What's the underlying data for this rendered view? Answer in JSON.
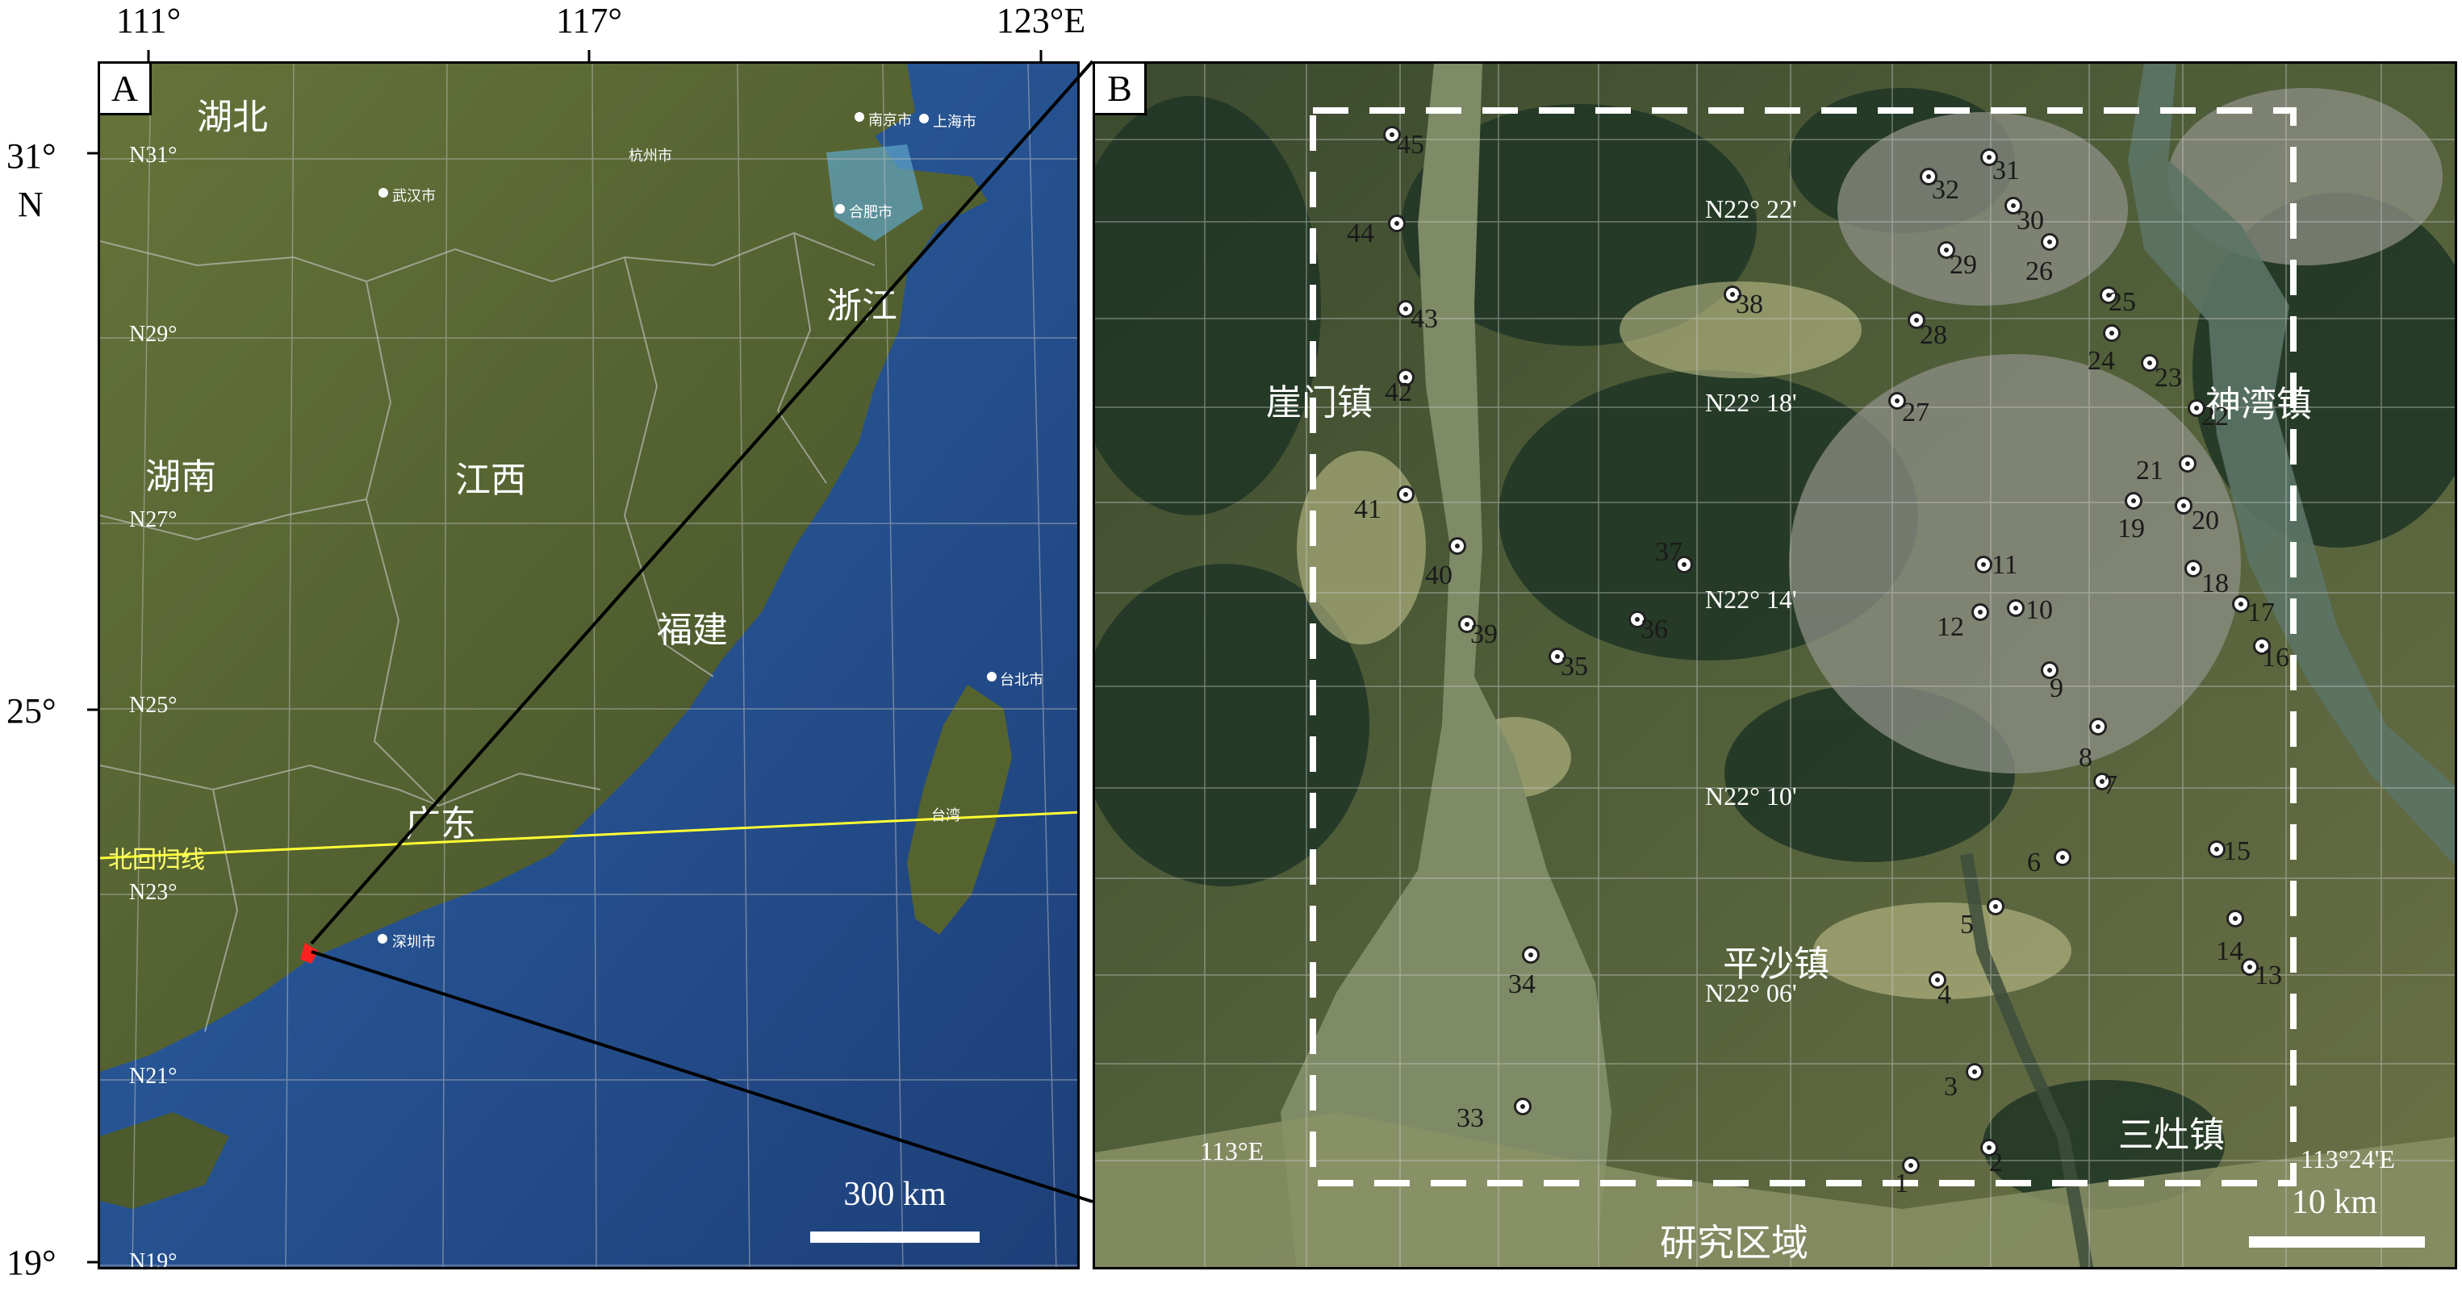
{
  "axes": {
    "top_labels": [
      {
        "text": "111°",
        "left": 0.0
      },
      {
        "text": "117°",
        "left": 0.5
      },
      {
        "text": "123°E",
        "left": 1.0
      }
    ],
    "left_labels": [
      {
        "text": "31°",
        "top": 0.0
      },
      {
        "text": "N",
        "top": 0.05
      },
      {
        "text": "25°",
        "top": 0.5
      },
      {
        "text": "19°",
        "top": 1.0
      }
    ]
  },
  "panel_a": {
    "label": "A",
    "provinces": [
      "湖北",
      "湖南",
      "江西",
      "浙江",
      "福建",
      "广东"
    ],
    "lat_labels": [
      "N31°",
      "N29°",
      "N27°",
      "N25°",
      "N23°",
      "N21°",
      "N19°"
    ],
    "cities": [
      "武汉市",
      "南京市",
      "上海市",
      "合肥市",
      "杭州市",
      "台北市",
      "深圳市",
      "台湾"
    ],
    "tropic_label": "北回归线",
    "scale": "300 km"
  },
  "panel_b": {
    "label": "B",
    "towns": [
      "崖门镇",
      "神湾镇",
      "平沙镇",
      "三灶镇"
    ],
    "grid_labels": [
      "N22° 22'",
      "N22° 18'",
      "N22° 14'",
      "N22° 10'",
      "N22° 06'"
    ],
    "lon_left": "113°E",
    "lon_right": "113°24'E",
    "study_area": "研究区域",
    "scale": "10 km",
    "sites": [
      {
        "n": "1"
      },
      {
        "n": "2"
      },
      {
        "n": "3"
      },
      {
        "n": "4"
      },
      {
        "n": "5"
      },
      {
        "n": "6"
      },
      {
        "n": "7"
      },
      {
        "n": "8"
      },
      {
        "n": "9"
      },
      {
        "n": "10"
      },
      {
        "n": "11"
      },
      {
        "n": "12"
      },
      {
        "n": "13"
      },
      {
        "n": "14"
      },
      {
        "n": "15"
      },
      {
        "n": "16"
      },
      {
        "n": "17"
      },
      {
        "n": "18"
      },
      {
        "n": "19"
      },
      {
        "n": "20"
      },
      {
        "n": "21"
      },
      {
        "n": "22"
      },
      {
        "n": "23"
      },
      {
        "n": "24"
      },
      {
        "n": "25"
      },
      {
        "n": "26"
      },
      {
        "n": "27"
      },
      {
        "n": "28"
      },
      {
        "n": "29"
      },
      {
        "n": "30"
      },
      {
        "n": "31"
      },
      {
        "n": "32"
      },
      {
        "n": "33"
      },
      {
        "n": "34"
      },
      {
        "n": "35"
      },
      {
        "n": "36"
      },
      {
        "n": "37"
      },
      {
        "n": "38"
      },
      {
        "n": "39"
      },
      {
        "n": "40"
      },
      {
        "n": "41"
      },
      {
        "n": "42"
      },
      {
        "n": "43"
      },
      {
        "n": "44"
      },
      {
        "n": "45"
      }
    ]
  },
  "colors": {
    "land": "#5b6a35",
    "sea": "#2d5a9a",
    "tropic_line": "#ffff33",
    "leader_line": "#000000",
    "study_box": "#ffffff",
    "marker": "#ff2020"
  }
}
